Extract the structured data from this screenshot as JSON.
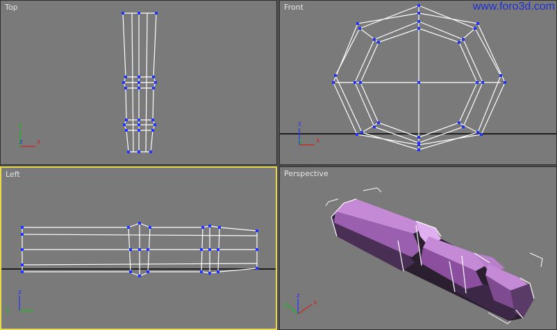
{
  "watermark": "www.foro3d.com",
  "viewports": {
    "top": {
      "label": "Top"
    },
    "front": {
      "label": "Front"
    },
    "left": {
      "label": "Left"
    },
    "perspective": {
      "label": "Perspective"
    }
  },
  "axis": {
    "x": "x",
    "y": "y",
    "z": "z"
  },
  "colors": {
    "background": "#7a7a7a",
    "wire": "#ffffff",
    "vertex": "#2233ff",
    "active_border": "#e9d84a",
    "grid_line": "#000000",
    "axis_x": "#d02020",
    "axis_y": "#10c010",
    "axis_z": "#2030ff",
    "mesh_light": "#c48ad6",
    "mesh_dark": "#2a1f2e"
  }
}
